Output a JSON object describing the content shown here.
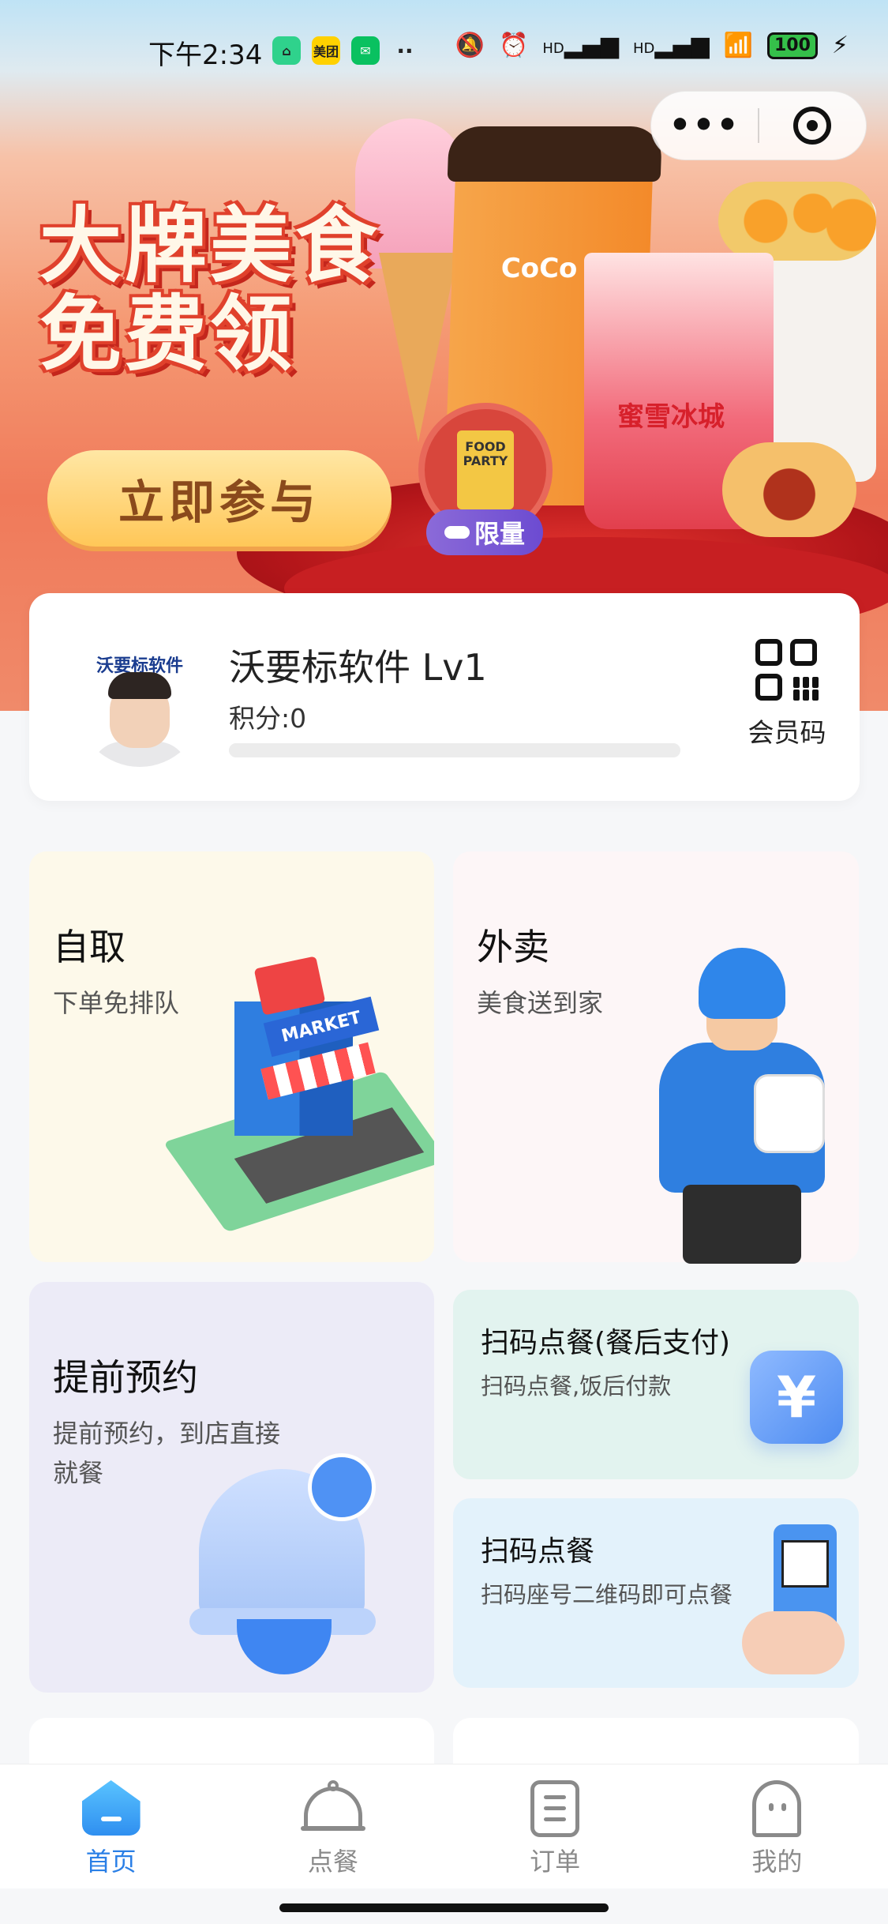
{
  "status_bar": {
    "time": "下午2:34",
    "apps": [
      "美团"
    ],
    "battery": "100",
    "network_labels": [
      "HD",
      "HD"
    ]
  },
  "capsule": {
    "more": "•••"
  },
  "banner": {
    "title_line1": "大牌美食",
    "title_line2": "免费领",
    "button": "立即参与",
    "badge": "限量",
    "brand_coco": "CoCo",
    "brand_mixue": "蜜雪冰城",
    "food_party": "FOOD PARTY"
  },
  "member": {
    "brand_logo": "沃要标软件",
    "name": "沃要标软件 Lv1",
    "points": "积分:0",
    "progress": 0,
    "qr_label": "会员码"
  },
  "services": {
    "self_pickup": {
      "title": "自取",
      "subtitle": "下单免排队",
      "sign": "MARKET"
    },
    "delivery": {
      "title": "外卖",
      "subtitle": "美食送到家"
    },
    "reserve": {
      "title": "提前预约",
      "subtitle": "提前预约，到店直接就餐"
    },
    "scan_pay_after": {
      "title": "扫码点餐(餐后支付)",
      "subtitle": "扫码点餐,饭后付款",
      "icon_char": "¥"
    },
    "scan_order": {
      "title": "扫码点餐",
      "subtitle": "扫码座号二维码即可点餐"
    }
  },
  "tabbar": {
    "items": [
      {
        "label": "首页",
        "active": true
      },
      {
        "label": "点餐",
        "active": false
      },
      {
        "label": "订单",
        "active": false
      },
      {
        "label": "我的",
        "active": false
      }
    ]
  },
  "colors": {
    "accent": "#2a7fe6",
    "tab_inactive": "#8a8a8a"
  }
}
